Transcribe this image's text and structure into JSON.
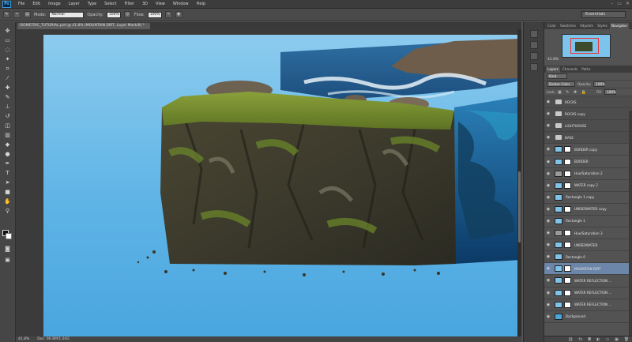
{
  "app": {
    "logo": "Ps",
    "window_controls": [
      "–",
      "▭",
      "✕"
    ]
  },
  "menu": [
    "File",
    "Edit",
    "Image",
    "Layer",
    "Type",
    "Select",
    "Filter",
    "3D",
    "View",
    "Window",
    "Help"
  ],
  "options": {
    "mode_label": "Mode:",
    "mode_value": "Normal",
    "opacity_label": "Opacity:",
    "opacity_value": "100%",
    "flow_label": "Flow:",
    "flow_value": "100%",
    "workspace": "Essentials"
  },
  "document": {
    "tab_title": "ISOMETRIC_TUTORIAL.psd @ 41.8% (MOUNTAIN DIRT, Layer Mask/8) *"
  },
  "status": {
    "zoom": "41.8%",
    "doc": "Doc: 96.8M/1.04G"
  },
  "panels": {
    "top_tabs": [
      "Color",
      "Swatches",
      "Adjustm",
      "Styles",
      "Navigator"
    ],
    "top_active": 4,
    "navigator_zoom": "41.8%",
    "layer_tabs": [
      "Layers",
      "Channels",
      "Paths"
    ],
    "kind_label": "Kind",
    "blend_mode": "Darker Color",
    "opacity_label": "Opacity:",
    "opacity_value": "100%",
    "lock_label": "Lock:",
    "fill_label": "Fill:",
    "fill_value": "100%"
  },
  "layers": [
    {
      "name": "ROCKS",
      "kind": "group"
    },
    {
      "name": "ROCKS copy",
      "kind": "group"
    },
    {
      "name": "LIGHTHOUSE",
      "kind": "group"
    },
    {
      "name": "BASE",
      "kind": "group"
    },
    {
      "name": "BORDER copy",
      "kind": "layer"
    },
    {
      "name": "BORDER",
      "kind": "layer"
    },
    {
      "name": "Hue/Saturation 2",
      "kind": "adjust"
    },
    {
      "name": "WATER copy 2",
      "kind": "layer"
    },
    {
      "name": "Rectangle 1 copy",
      "kind": "shape"
    },
    {
      "name": "UNDERWATER copy",
      "kind": "layer"
    },
    {
      "name": "Rectangle 1",
      "kind": "shape"
    },
    {
      "name": "Hue/Saturation 3",
      "kind": "adjust"
    },
    {
      "name": "UNDERWATER",
      "kind": "layer"
    },
    {
      "name": "Rectangle 0",
      "kind": "shape"
    },
    {
      "name": "MOUNTAIN DIRT",
      "kind": "layer",
      "selected": true
    },
    {
      "name": "WATER REFLECTION ...",
      "kind": "layer"
    },
    {
      "name": "WATER REFLECTION ...",
      "kind": "layer"
    },
    {
      "name": "WATER REFLECTION ...",
      "kind": "layer"
    },
    {
      "name": "Background",
      "kind": "bg"
    }
  ],
  "colors": {
    "accent": "#6b86a8",
    "sky": "#5fb4e6",
    "panel": "#535353"
  }
}
